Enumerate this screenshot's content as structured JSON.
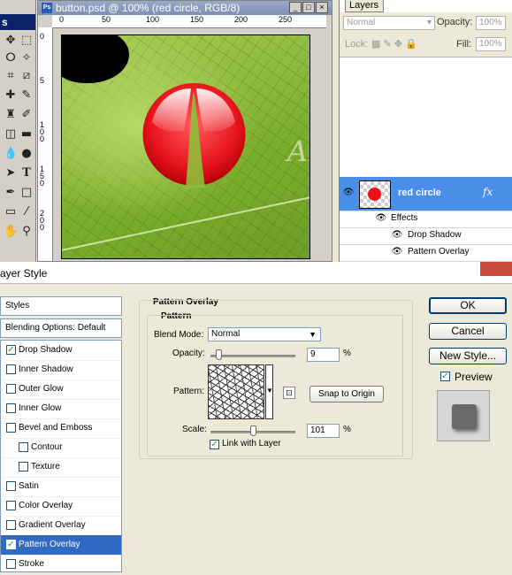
{
  "tools": {
    "header": "s",
    "icons": [
      "move-icon",
      "marquee-icon",
      "lasso-icon",
      "magic-wand-icon",
      "crop-icon",
      "slice-icon",
      "healing-brush-icon",
      "brush-icon",
      "clone-stamp-icon",
      "history-brush-icon",
      "eraser-icon",
      "gradient-icon",
      "blur-icon",
      "dodge-icon",
      "path-select-icon",
      "type-icon",
      "pen-icon",
      "shape-icon",
      "notes-icon",
      "eyedropper-icon",
      "hand-icon",
      "zoom-icon"
    ]
  },
  "document": {
    "title": "button.psd @ 100% (red circle, RGB/8)",
    "app_badge": "Ps",
    "ruler_top": [
      "0",
      "50",
      "100",
      "150",
      "200",
      "250"
    ],
    "ruler_left": [
      "0",
      "5",
      "1 0 0",
      "1 5 0",
      "2 0 0"
    ],
    "watermark": "Alfoart.com"
  },
  "layers": {
    "tab": "Layers",
    "blend_mode": "Normal",
    "opacity_label": "Opacity:",
    "opacity_value": "100%",
    "lock_label": "Lock:",
    "fill_label": "Fill:",
    "fill_value": "100%",
    "layer_name": "red circle",
    "fx": "fx",
    "effects": [
      {
        "label": "Effects"
      },
      {
        "label": "Drop Shadow"
      },
      {
        "label": "Pattern Overlay"
      }
    ]
  },
  "dialog": {
    "title": "ayer Style",
    "styles_header": "Styles",
    "blending_options": "Blending Options: Default",
    "styles": [
      {
        "label": "Drop Shadow",
        "checked": true,
        "selected": false,
        "indent": false
      },
      {
        "label": "Inner Shadow",
        "checked": false,
        "selected": false,
        "indent": false
      },
      {
        "label": "Outer Glow",
        "checked": false,
        "selected": false,
        "indent": false
      },
      {
        "label": "Inner Glow",
        "checked": false,
        "selected": false,
        "indent": false
      },
      {
        "label": "Bevel and Emboss",
        "checked": false,
        "selected": false,
        "indent": false
      },
      {
        "label": "Contour",
        "checked": false,
        "selected": false,
        "indent": true
      },
      {
        "label": "Texture",
        "checked": false,
        "selected": false,
        "indent": true
      },
      {
        "label": "Satin",
        "checked": false,
        "selected": false,
        "indent": false
      },
      {
        "label": "Color Overlay",
        "checked": false,
        "selected": false,
        "indent": false
      },
      {
        "label": "Gradient Overlay",
        "checked": false,
        "selected": false,
        "indent": false
      },
      {
        "label": "Pattern Overlay",
        "checked": true,
        "selected": true,
        "indent": false
      },
      {
        "label": "Stroke",
        "checked": false,
        "selected": false,
        "indent": false
      }
    ],
    "section_title": "Pattern Overlay",
    "group_title": "Pattern",
    "blend_mode_label": "Blend Mode:",
    "blend_mode_value": "Normal",
    "opacity_label": "Opacity:",
    "opacity_value": "9",
    "opacity_level": 0.09,
    "percent": "%",
    "pattern_label": "Pattern:",
    "snap_to_origin": "Snap to Origin",
    "scale_label": "Scale:",
    "scale_value": "101",
    "scale_level": 0.101,
    "link_with_layer": "Link with Layer",
    "link_checked": true,
    "ok": "OK",
    "cancel": "Cancel",
    "new_style": "New Style...",
    "preview_label": "Preview",
    "preview_checked": true
  },
  "colors": {
    "selection": "#316ac5",
    "red_circle": "#e8141c",
    "layer_selected": "#4a8ee8"
  }
}
